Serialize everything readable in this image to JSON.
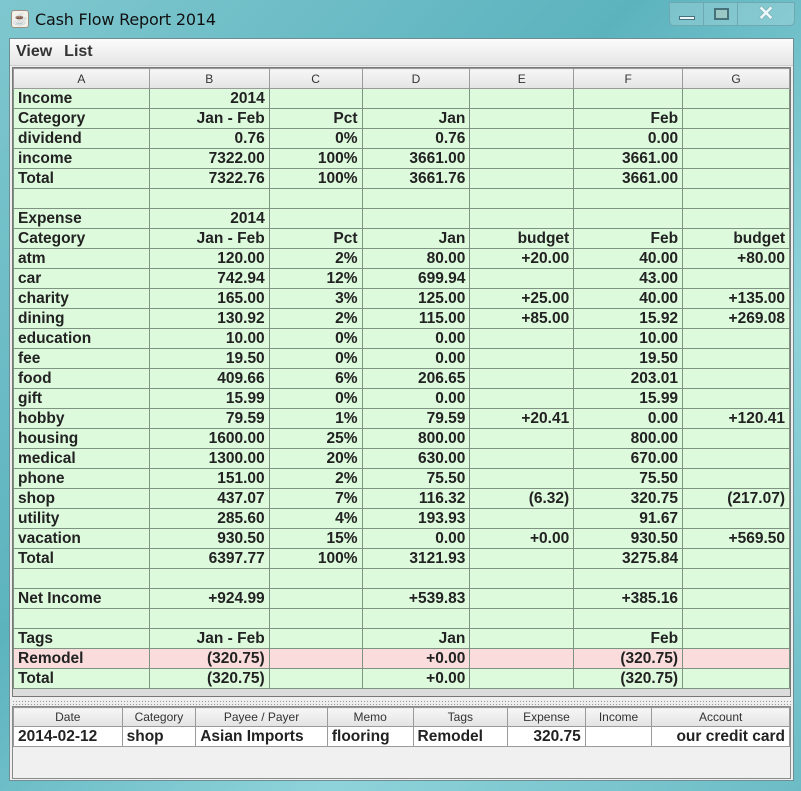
{
  "window": {
    "title": "Cash Flow Report 2014",
    "icon": "java-cup-icon",
    "controls": [
      "minimize",
      "maximize",
      "close"
    ]
  },
  "menu": [
    "View",
    "List"
  ],
  "report": {
    "columns": [
      "A",
      "B",
      "C",
      "D",
      "E",
      "F",
      "G"
    ],
    "rows": [
      {
        "cells": [
          "Income",
          "2014",
          "",
          "",
          "",
          "",
          ""
        ]
      },
      {
        "cells": [
          "Category",
          "Jan - Feb",
          "Pct",
          "Jan",
          "",
          "Feb",
          ""
        ]
      },
      {
        "cells": [
          "dividend",
          "0.76",
          "0%",
          "0.76",
          "",
          "0.00",
          ""
        ]
      },
      {
        "cells": [
          "income",
          "7322.00",
          "100%",
          "3661.00",
          "",
          "3661.00",
          ""
        ]
      },
      {
        "cells": [
          "Total",
          "7322.76",
          "100%",
          "3661.76",
          "",
          "3661.00",
          ""
        ]
      },
      {
        "cells": [
          "",
          "",
          "",
          "",
          "",
          "",
          ""
        ]
      },
      {
        "cells": [
          "Expense",
          "2014",
          "",
          "",
          "",
          "",
          ""
        ]
      },
      {
        "cells": [
          "Category",
          "Jan - Feb",
          "Pct",
          "Jan",
          "budget",
          "Feb",
          "budget"
        ]
      },
      {
        "cells": [
          "atm",
          "120.00",
          "2%",
          "80.00",
          "+20.00",
          "40.00",
          "+80.00"
        ]
      },
      {
        "cells": [
          "car",
          "742.94",
          "12%",
          "699.94",
          "",
          "43.00",
          ""
        ]
      },
      {
        "cells": [
          "charity",
          "165.00",
          "3%",
          "125.00",
          "+25.00",
          "40.00",
          "+135.00"
        ]
      },
      {
        "cells": [
          "dining",
          "130.92",
          "2%",
          "115.00",
          "+85.00",
          "15.92",
          "+269.08"
        ]
      },
      {
        "cells": [
          "education",
          "10.00",
          "0%",
          "0.00",
          "",
          "10.00",
          ""
        ]
      },
      {
        "cells": [
          "fee",
          "19.50",
          "0%",
          "0.00",
          "",
          "19.50",
          ""
        ]
      },
      {
        "cells": [
          "food",
          "409.66",
          "6%",
          "206.65",
          "",
          "203.01",
          ""
        ]
      },
      {
        "cells": [
          "gift",
          "15.99",
          "0%",
          "0.00",
          "",
          "15.99",
          ""
        ]
      },
      {
        "cells": [
          "hobby",
          "79.59",
          "1%",
          "79.59",
          "+20.41",
          "0.00",
          "+120.41"
        ]
      },
      {
        "cells": [
          "housing",
          "1600.00",
          "25%",
          "800.00",
          "",
          "800.00",
          ""
        ]
      },
      {
        "cells": [
          "medical",
          "1300.00",
          "20%",
          "630.00",
          "",
          "670.00",
          ""
        ]
      },
      {
        "cells": [
          "phone",
          "151.00",
          "2%",
          "75.50",
          "",
          "75.50",
          ""
        ]
      },
      {
        "cells": [
          "shop",
          "437.07",
          "7%",
          "116.32",
          "(6.32)",
          "320.75",
          "(217.07)"
        ]
      },
      {
        "cells": [
          "utility",
          "285.60",
          "4%",
          "193.93",
          "",
          "91.67",
          ""
        ]
      },
      {
        "cells": [
          "vacation",
          "930.50",
          "15%",
          "0.00",
          "+0.00",
          "930.50",
          "+569.50"
        ]
      },
      {
        "cells": [
          "Total",
          "6397.77",
          "100%",
          "3121.93",
          "",
          "3275.84",
          ""
        ]
      },
      {
        "cells": [
          "",
          "",
          "",
          "",
          "",
          "",
          ""
        ]
      },
      {
        "cells": [
          "Net Income",
          "+924.99",
          "",
          "+539.83",
          "",
          "+385.16",
          ""
        ]
      },
      {
        "cells": [
          "",
          "",
          "",
          "",
          "",
          "",
          ""
        ]
      },
      {
        "cells": [
          "Tags",
          "Jan - Feb",
          "",
          "Jan",
          "",
          "Feb",
          ""
        ]
      },
      {
        "cells": [
          "Remodel",
          "(320.75)",
          "",
          "+0.00",
          "",
          "(320.75)",
          ""
        ],
        "highlight": true
      },
      {
        "cells": [
          "Total",
          "(320.75)",
          "",
          "+0.00",
          "",
          "(320.75)",
          ""
        ]
      }
    ]
  },
  "detail": {
    "columns": [
      "Date",
      "Category",
      "Payee / Payer",
      "Memo",
      "Tags",
      "Expense",
      "Income",
      "Account"
    ],
    "rows": [
      {
        "cells": [
          "2014-02-12",
          "shop",
          "Asian Imports",
          "flooring",
          "Remodel",
          "320.75",
          "",
          "our credit card"
        ]
      }
    ]
  },
  "colors": {
    "cell_bg": "#ddfadd",
    "highlight_bg": "#fadcdc",
    "grid_line": "#7f9383"
  }
}
